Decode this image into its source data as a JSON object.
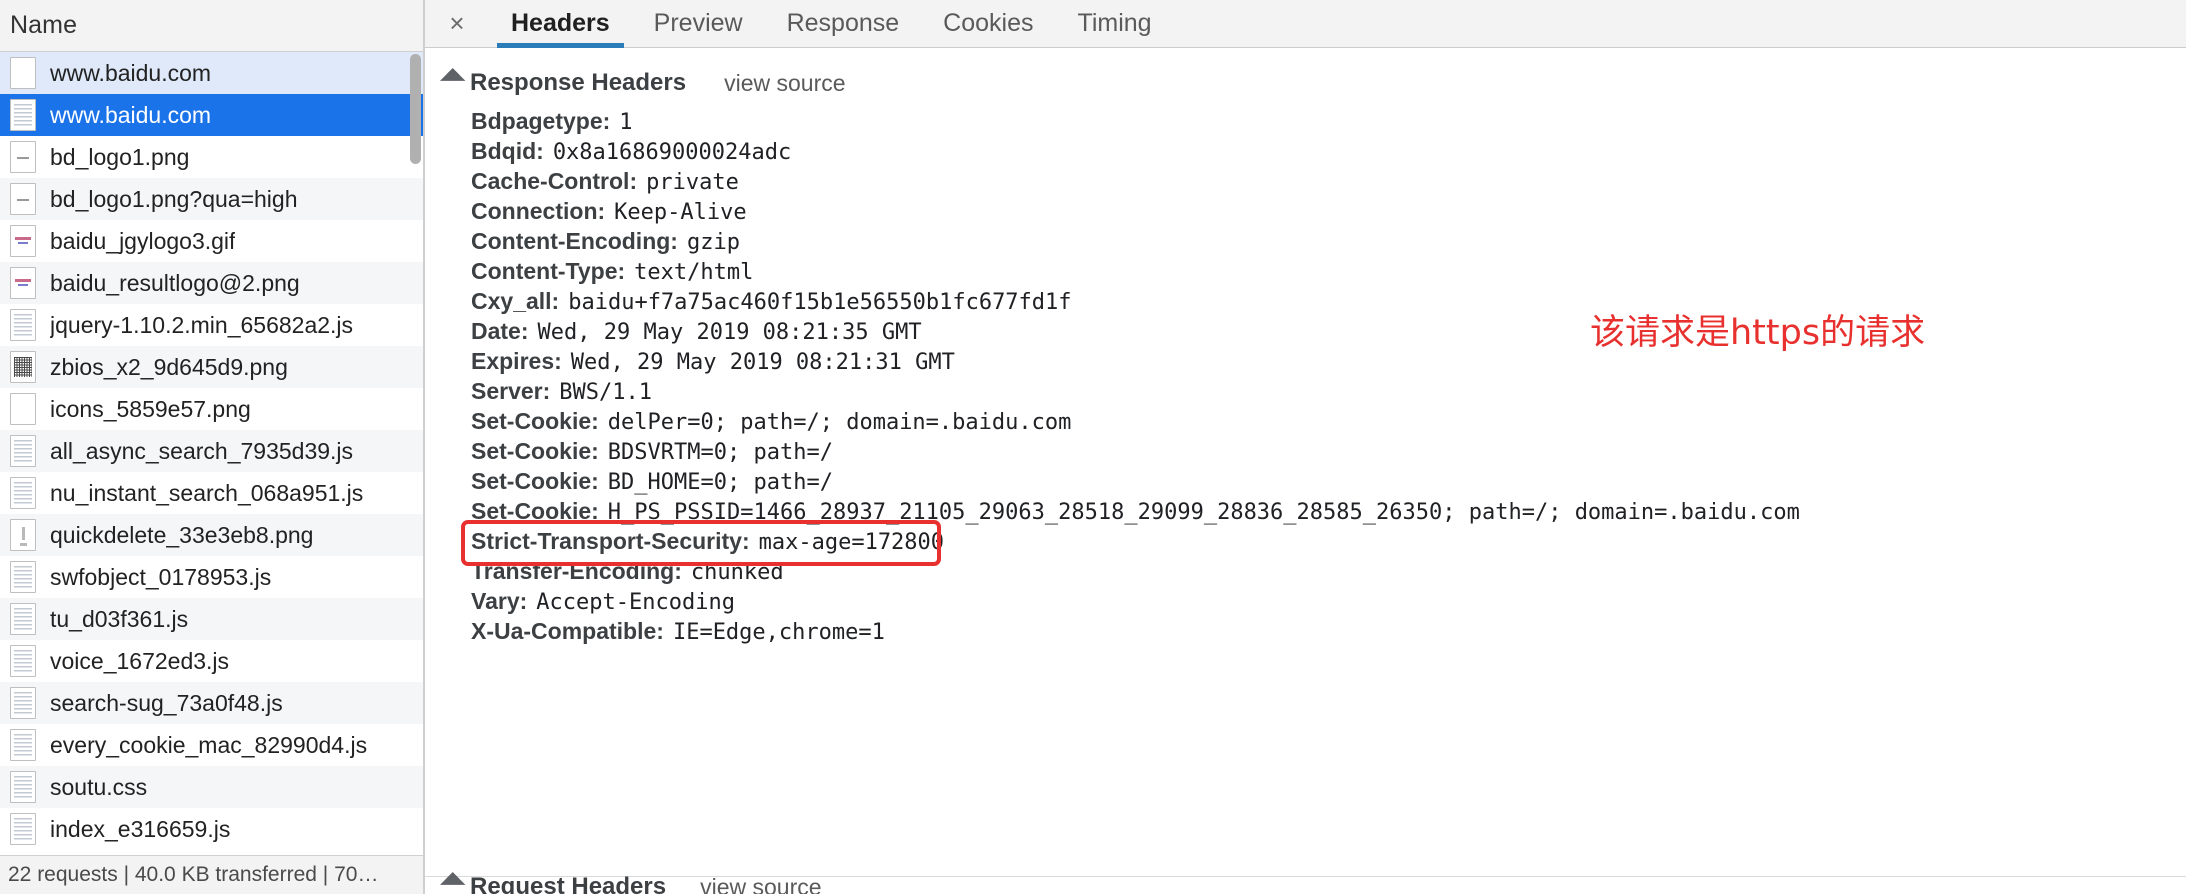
{
  "left_panel": {
    "column_header": "Name",
    "rows": [
      {
        "name": "www.baidu.com",
        "icon": "blank-document-icon",
        "state": "hover"
      },
      {
        "name": "www.baidu.com",
        "icon": "document-icon",
        "state": "selected"
      },
      {
        "name": "bd_logo1.png",
        "icon": "dash-image-icon",
        "state": "even"
      },
      {
        "name": "bd_logo1.png?qua=high",
        "icon": "dash-image-icon",
        "state": "odd"
      },
      {
        "name": "baidu_jgylogo3.gif",
        "icon": "image-icon",
        "state": "even"
      },
      {
        "name": "baidu_resultlogo@2.png",
        "icon": "image-icon",
        "state": "odd"
      },
      {
        "name": "jquery-1.10.2.min_65682a2.js",
        "icon": "document-icon",
        "state": "even"
      },
      {
        "name": "zbios_x2_9d645d9.png",
        "icon": "qr-image-icon",
        "state": "odd"
      },
      {
        "name": "icons_5859e57.png",
        "icon": "blank-document-icon",
        "state": "even"
      },
      {
        "name": "all_async_search_7935d39.js",
        "icon": "document-icon",
        "state": "odd"
      },
      {
        "name": "nu_instant_search_068a951.js",
        "icon": "document-icon",
        "state": "even"
      },
      {
        "name": "quickdelete_33e3eb8.png",
        "icon": "mark-image-icon",
        "state": "odd"
      },
      {
        "name": "swfobject_0178953.js",
        "icon": "document-icon",
        "state": "even"
      },
      {
        "name": "tu_d03f361.js",
        "icon": "document-icon",
        "state": "odd"
      },
      {
        "name": "voice_1672ed3.js",
        "icon": "document-icon",
        "state": "even"
      },
      {
        "name": "search-sug_73a0f48.js",
        "icon": "document-icon",
        "state": "odd"
      },
      {
        "name": "every_cookie_mac_82990d4.js",
        "icon": "document-icon",
        "state": "even"
      },
      {
        "name": "soutu.css",
        "icon": "document-icon",
        "state": "odd"
      },
      {
        "name": "index_e316659.js",
        "icon": "document-icon",
        "state": "even"
      }
    ],
    "status_bar": "22 requests | 40.0 KB transferred | 70…"
  },
  "tabbar": {
    "close_label": "×",
    "tabs": [
      {
        "label": "Headers",
        "active": true
      },
      {
        "label": "Preview",
        "active": false
      },
      {
        "label": "Response",
        "active": false
      },
      {
        "label": "Cookies",
        "active": false
      },
      {
        "label": "Timing",
        "active": false
      }
    ]
  },
  "detail": {
    "response_section_title": "Response Headers",
    "request_section_title": "Request Headers",
    "view_source_label": "view source",
    "headers": [
      {
        "name": "Bdpagetype:",
        "value": "1"
      },
      {
        "name": "Bdqid:",
        "value": "0x8a16869000024adc"
      },
      {
        "name": "Cache-Control:",
        "value": "private"
      },
      {
        "name": "Connection:",
        "value": "Keep-Alive"
      },
      {
        "name": "Content-Encoding:",
        "value": "gzip"
      },
      {
        "name": "Content-Type:",
        "value": "text/html"
      },
      {
        "name": "Cxy_all:",
        "value": "baidu+f7a75ac460f15b1e56550b1fc677fd1f"
      },
      {
        "name": "Date:",
        "value": "Wed, 29 May 2019 08:21:35 GMT"
      },
      {
        "name": "Expires:",
        "value": "Wed, 29 May 2019 08:21:31 GMT"
      },
      {
        "name": "Server:",
        "value": "BWS/1.1"
      },
      {
        "name": "Set-Cookie:",
        "value": "delPer=0; path=/; domain=.baidu.com"
      },
      {
        "name": "Set-Cookie:",
        "value": "BDSVRTM=0; path=/"
      },
      {
        "name": "Set-Cookie:",
        "value": "BD_HOME=0; path=/"
      },
      {
        "name": "Set-Cookie:",
        "value": "H_PS_PSSID=1466_28937_21105_29063_28518_29099_28836_28585_26350; path=/; domain=.baidu.com"
      },
      {
        "name": "Strict-Transport-Security:",
        "value": "max-age=172800",
        "highlighted": true
      },
      {
        "name": "Transfer-Encoding:",
        "value": "chunked"
      },
      {
        "name": "Vary:",
        "value": "Accept-Encoding"
      },
      {
        "name": "X-Ua-Compatible:",
        "value": "IE=Edge,chrome=1"
      }
    ],
    "annotation": "该请求是https的请求"
  },
  "colors": {
    "selection_blue": "#1a73e8",
    "hover_blue": "#dfe9f9",
    "tab_underline": "#2b7cb8",
    "annotation_red": "#e8312f",
    "header_bg": "#f3f3f3"
  }
}
